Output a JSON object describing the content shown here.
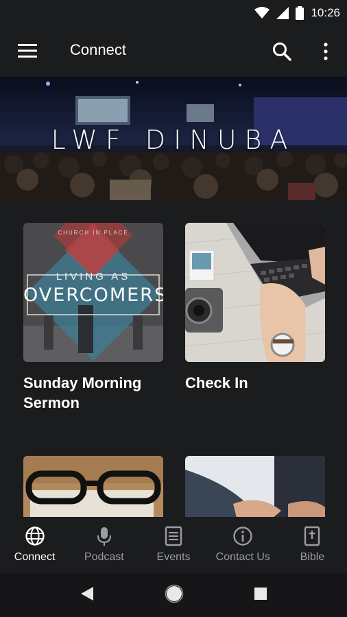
{
  "status_bar": {
    "time": "10:26"
  },
  "app_bar": {
    "title": "Connect"
  },
  "hero": {
    "title": "LWF DINUBA"
  },
  "cards": [
    {
      "label": "Sunday Morning Sermon",
      "thumb_text_top": "LIVING AS",
      "thumb_text_main": "OVERCOMERS",
      "thumb_text_header": "CHURCH IN PLACE"
    },
    {
      "label": "Check In"
    },
    {
      "label": ""
    },
    {
      "label": ""
    }
  ],
  "bottom_nav": [
    {
      "label": "Connect",
      "icon": "globe-icon",
      "active": true
    },
    {
      "label": "Podcast",
      "icon": "microphone-icon",
      "active": false
    },
    {
      "label": "Events",
      "icon": "events-icon",
      "active": false
    },
    {
      "label": "Contact Us",
      "icon": "info-icon",
      "active": false
    },
    {
      "label": "Bible",
      "icon": "bible-icon",
      "active": false
    }
  ],
  "colors": {
    "background": "#1b1c1e",
    "nav_inactive": "#9c9da0",
    "nav_active": "#ffffff"
  }
}
